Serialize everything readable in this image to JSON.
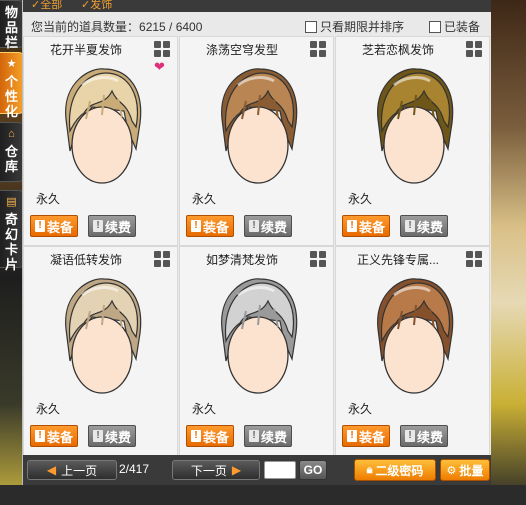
{
  "side_tabs": [
    {
      "label": "物品栏",
      "icon": "bag-icon",
      "active": false
    },
    {
      "label": "个性化",
      "icon": "star-icon",
      "active": true
    },
    {
      "label": "仓库",
      "icon": "house-icon",
      "active": false
    },
    {
      "label": "奇幻卡片",
      "icon": "card-icon",
      "active": false
    }
  ],
  "top_strip": {
    "tab_all": "✓全部",
    "tab_hair": "✓发饰"
  },
  "summary": {
    "label": "您当前的道具数量：",
    "count": "6215 / 6400"
  },
  "filters": {
    "limited_only": "只看期限并排序",
    "equipped": "已装备"
  },
  "items": [
    {
      "name": "花开半夏发饰",
      "duration": "永久",
      "equip": "装备",
      "renew": "续费",
      "hair_color": "#e8d4a8",
      "shade": "#c9ab77",
      "has_heart": true
    },
    {
      "name": "涤荡空穹发型",
      "duration": "永久",
      "equip": "装备",
      "renew": "续费",
      "hair_color": "#b98552",
      "shade": "#8a5c33",
      "has_heart": false
    },
    {
      "name": "芝若恋枫发饰",
      "duration": "永久",
      "equip": "装备",
      "renew": "续费",
      "hair_color": "#a88430",
      "shade": "#6e5518",
      "has_heart": false
    },
    {
      "name": "凝语低转发饰",
      "duration": "永久",
      "equip": "装备",
      "renew": "续费",
      "hair_color": "#e3d2b4",
      "shade": "#bda784",
      "has_heart": false
    },
    {
      "name": "如梦清梵发饰",
      "duration": "永久",
      "equip": "装备",
      "renew": "续费",
      "hair_color": "#d2d2d2",
      "shade": "#9a9a9a",
      "has_heart": false
    },
    {
      "name": "正义先锋专属...",
      "duration": "永久",
      "equip": "装备",
      "renew": "续费",
      "hair_color": "#b97a4a",
      "shade": "#85512d",
      "has_heart": false
    }
  ],
  "pager": {
    "prev": "上一页",
    "page": "2/417",
    "next": "下一页",
    "go": "GO",
    "input_value": ""
  },
  "actions": {
    "secondary_password": "二级密码",
    "batch": "批量"
  },
  "colors": {
    "accent": "#ee7c00",
    "panel": "#e9e9e9",
    "bar": "#3a3a3a"
  }
}
